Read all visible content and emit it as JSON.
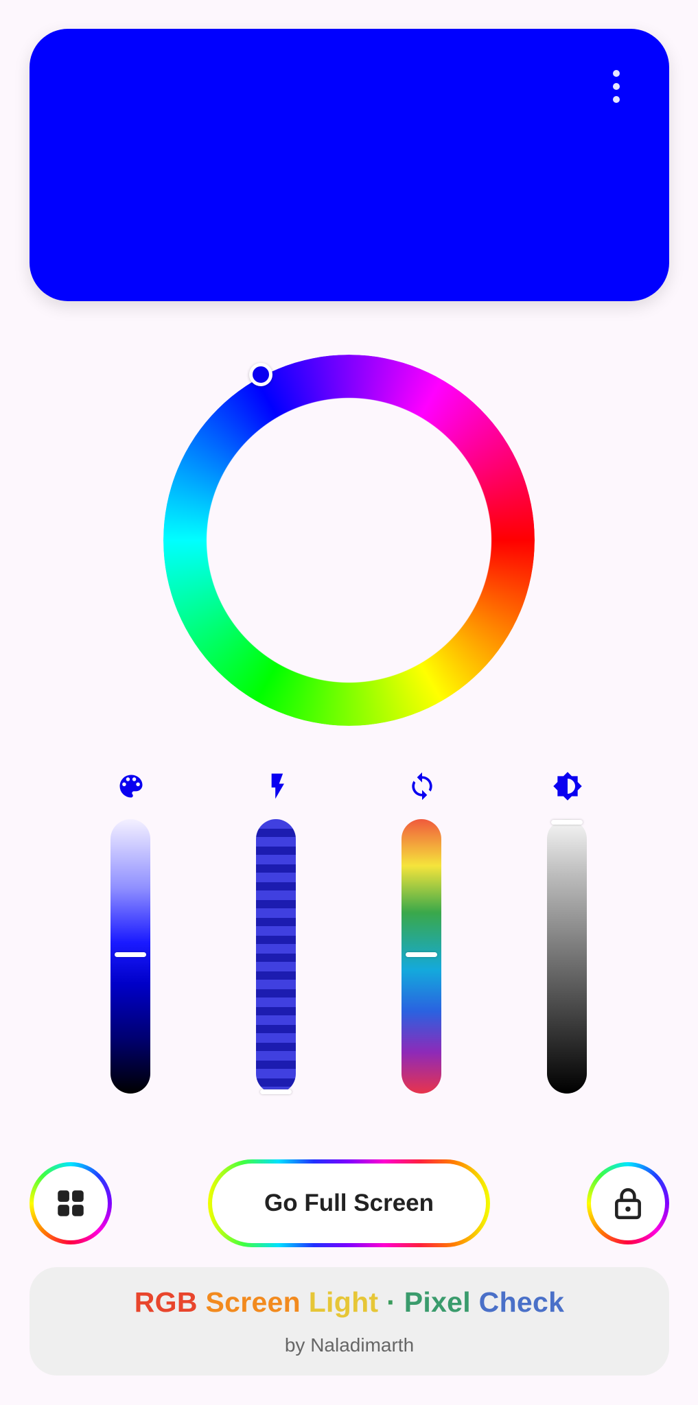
{
  "preview": {
    "color": "#0000FF"
  },
  "menu": {
    "icon": "more-vert-icon"
  },
  "color_wheel": {
    "selected_hue_deg": 240,
    "selected_color": "#0A00F0"
  },
  "sliders": [
    {
      "name": "saturation",
      "icon": "palette-icon",
      "value": 0.5
    },
    {
      "name": "strobe",
      "icon": "flash-icon",
      "value": 0.0
    },
    {
      "name": "hue-cycle",
      "icon": "sync-icon",
      "value": 0.5
    },
    {
      "name": "brightness",
      "icon": "brightness-icon",
      "value": 1.0
    }
  ],
  "controls": {
    "grid_icon": "grid-view-icon",
    "full_screen_label": "Go Full Screen",
    "lock_icon": "lock-open-icon"
  },
  "footer": {
    "brand_parts": [
      {
        "text": "RGB ",
        "color": "#E8452C"
      },
      {
        "text": "Screen ",
        "color": "#F28A1E"
      },
      {
        "text": "Light",
        "color": "#E6C637"
      },
      {
        "text": " · ",
        "color": "#3A9B5C"
      },
      {
        "text": "Pixel ",
        "color": "#3A9B6C"
      },
      {
        "text": "Check",
        "color": "#4A70C8"
      }
    ],
    "byline": "by Naladimarth"
  },
  "accent_color": "#0A00F0"
}
